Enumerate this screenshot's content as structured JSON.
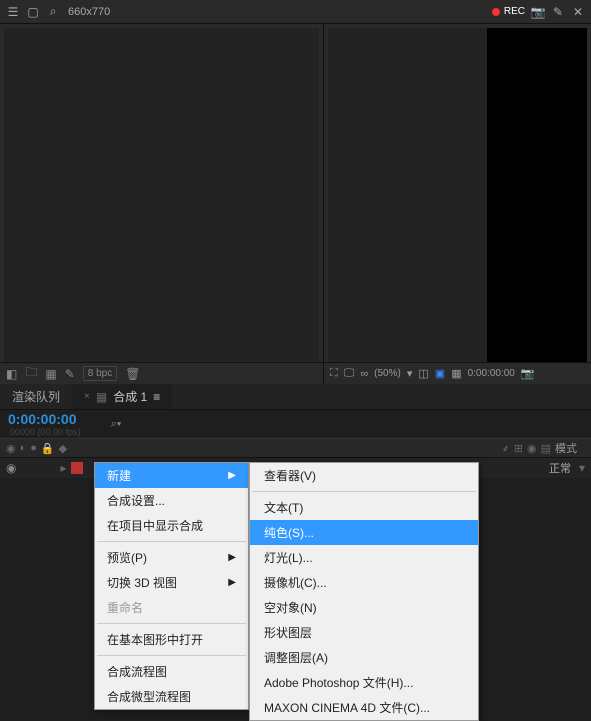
{
  "toolbar": {
    "search_text": "660x770",
    "rec": "REC"
  },
  "leftfooter": {
    "bpc": "8 bpc"
  },
  "rightfooter": {
    "zoom": "(50%)",
    "time": "0:00:00:00"
  },
  "tabs": {
    "render_queue": "渲染队列",
    "comp": "合成 1",
    "comp_menu": "≡"
  },
  "timeline": {
    "timecode": "0:00:00:00",
    "timesub": "00000 (00.00 fps)",
    "search_prompt": "⌕▾",
    "mode_header": "模式",
    "mode_value": "正常"
  },
  "ctx": {
    "new": "新建",
    "comp_settings": "合成设置...",
    "show_in_project": "在项目中显示合成",
    "preview": "预览(P)",
    "toggle3d": "切换 3D 视图",
    "rename": "重命名",
    "open_essential": "在基本图形中打开",
    "flowchart": "合成流程图",
    "mini_flowchart": "合成微型流程图"
  },
  "sub": {
    "viewer": "查看器(V)",
    "text": "文本(T)",
    "solid": "纯色(S)...",
    "light": "灯光(L)...",
    "camera": "摄像机(C)...",
    "null": "空对象(N)",
    "shape": "形状图层",
    "adjust": "调整图层(A)",
    "psd": "Adobe Photoshop 文件(H)...",
    "c4d": "MAXON CINEMA 4D 文件(C)..."
  }
}
